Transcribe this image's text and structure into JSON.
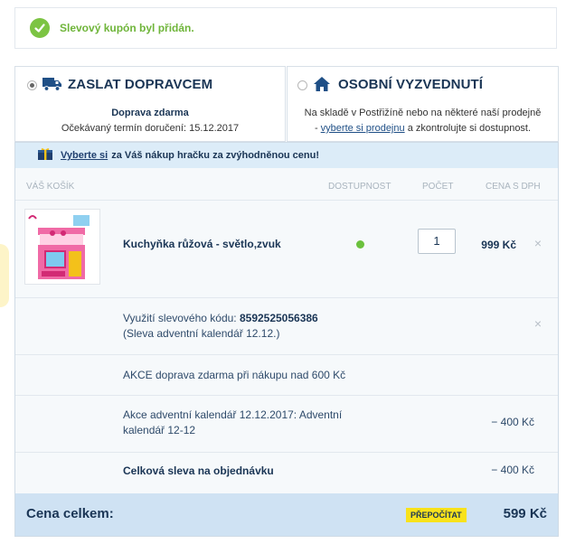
{
  "notice": {
    "message": "Slevový kupón byl přidán."
  },
  "shipping": {
    "carrier": {
      "title": "ZASLAT DOPRAVCEM",
      "line1": "Doprava zdarma",
      "line2_prefix": "Očekávaný termín doručení:",
      "line2_date": "15.12.2017",
      "selected": true
    },
    "pickup": {
      "title": "OSOBNÍ VYZVEDNUTÍ",
      "line1": "Na skladě v Postřižíně nebo na některé naší prodejně",
      "line2_dash": "-",
      "line2_link": "vyberte si prodejnu",
      "line2_suffix": "a zkontrolujte si dostupnost.",
      "selected": false
    }
  },
  "promo": {
    "link": "Vyberte si",
    "text": "za Váš nákup hračku za zvýhodněnou cenu!"
  },
  "table": {
    "headers": {
      "cart": "VÁŠ KOŠÍK",
      "availability": "DOSTUPNOST",
      "count": "POČET",
      "price": "CENA S DPH"
    }
  },
  "product": {
    "name": "Kuchyňka růžová - světlo,zvuk",
    "availability_color": "#6bc13d",
    "quantity": "1",
    "price": "999 Kč",
    "remove": "×"
  },
  "coupon": {
    "label": "Využití slevového kódu:",
    "code": "8592525056386",
    "note": "(Sleva adventní kalendář 12.12.)",
    "remove": "×"
  },
  "akce1": {
    "text": "AKCE doprava zdarma při nákupu nad 600 Kč"
  },
  "akce2": {
    "line1": "Akce adventní kalendář 12.12.2017: Adventní",
    "line2": "kalendář 12-12",
    "amount": "− 400 Kč"
  },
  "total_discount": {
    "label": "Celková sleva na objednávku",
    "amount": "− 400 Kč"
  },
  "total": {
    "label": "Cena celkem:",
    "recalc": "PŘEPOČÍTAT",
    "price": "599 Kč"
  },
  "colors": {
    "accent": "#1a3555",
    "success": "#6fb53a",
    "highlight": "#f8e21b",
    "total_bar": "#cfe2f3"
  }
}
